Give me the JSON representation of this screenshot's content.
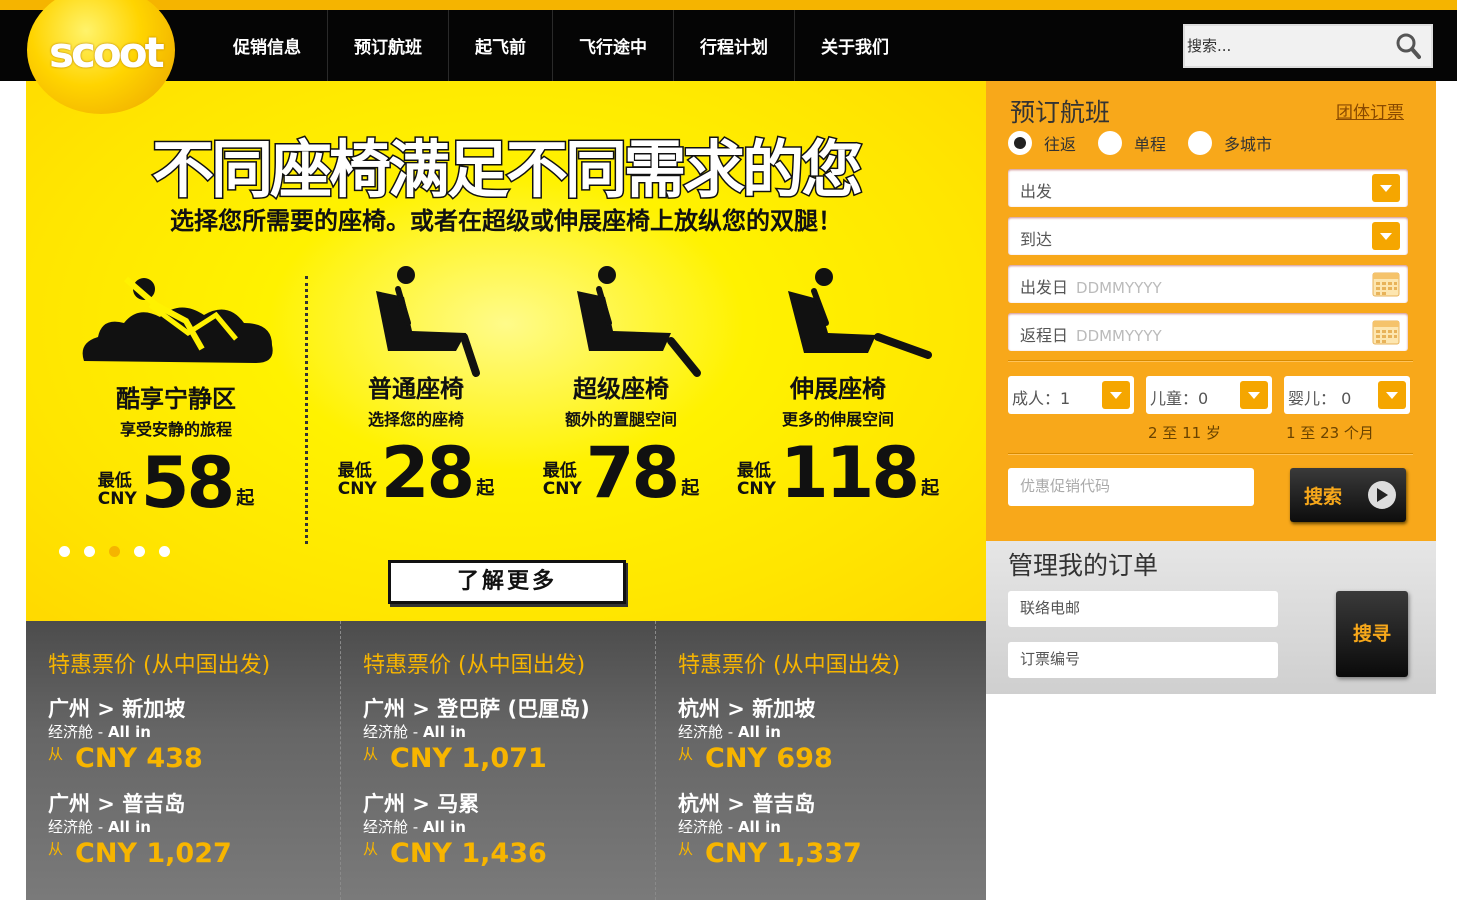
{
  "brand": {
    "logo_text": "scoot"
  },
  "nav": {
    "items": [
      "促销信息",
      "预订航班",
      "起飞前",
      "飞行途中",
      "行程计划",
      "关于我们"
    ],
    "search_placeholder": "搜索..."
  },
  "hero": {
    "title": "不同座椅满足不同需求的您",
    "subtitle": "选择您所需要的座椅。或者在超级或伸展座椅上放纵您的双腿！",
    "seats": [
      {
        "name": "酷享宁静区",
        "desc": "享受安静的旅程",
        "min_label_1": "最低",
        "min_label_2": "CNY",
        "price": "58",
        "suffix": "起"
      },
      {
        "name": "普通座椅",
        "desc": "选择您的座椅",
        "min_label_1": "最低",
        "min_label_2": "CNY",
        "price": "28",
        "suffix": "起"
      },
      {
        "name": "超级座椅",
        "desc": "额外的置腿空间",
        "min_label_1": "最低",
        "min_label_2": "CNY",
        "price": "78",
        "suffix": "起"
      },
      {
        "name": "伸展座椅",
        "desc": "更多的伸展空间",
        "min_label_1": "最低",
        "min_label_2": "CNY",
        "price": "118",
        "suffix": "起"
      }
    ],
    "carousel_active_index": 2,
    "learn_more": "了解更多"
  },
  "deals": {
    "columns": [
      {
        "heading": "特惠票价 (从中国出发)",
        "items": [
          {
            "route": "广州 > 新加坡",
            "class_prefix": "经济舱 - ",
            "class_name": "All in",
            "from": "从",
            "price": "CNY 438"
          },
          {
            "route": "广州 > 普吉岛",
            "class_prefix": "经济舱 - ",
            "class_name": "All in",
            "from": "从",
            "price": "CNY 1,027"
          }
        ]
      },
      {
        "heading": "特惠票价 (从中国出发)",
        "items": [
          {
            "route": "广州 > 登巴萨 (巴厘岛)",
            "class_prefix": "经济舱 - ",
            "class_name": "All in",
            "from": "从",
            "price": "CNY 1,071"
          },
          {
            "route": "广州 > 马累",
            "class_prefix": "经济舱 - ",
            "class_name": "All in",
            "from": "从",
            "price": "CNY 1,436"
          }
        ]
      },
      {
        "heading": "特惠票价 (从中国出发)",
        "items": [
          {
            "route": "杭州 > 新加坡",
            "class_prefix": "经济舱 - ",
            "class_name": "All in",
            "from": "从",
            "price": "CNY 698"
          },
          {
            "route": "杭州 > 普吉岛",
            "class_prefix": "经济舱 - ",
            "class_name": "All in",
            "from": "从",
            "price": "CNY 1,337"
          }
        ]
      }
    ]
  },
  "booking": {
    "title": "预订航班",
    "group_link": "团体订票",
    "trip_types": [
      "往返",
      "单程",
      "多城市"
    ],
    "selected_trip_type": "往返",
    "origin_label": "出发",
    "destination_label": "到达",
    "depart_label": "出发日",
    "depart_placeholder": "DDMMYYYY",
    "return_label": "返程日",
    "return_placeholder": "DDMMYYYY",
    "adults_label": "成人：1",
    "children_label": "儿童：0",
    "infants_label": "婴儿： 0",
    "children_hint": "2 至 11 岁",
    "infants_hint": "1 至 23 个月",
    "promo_placeholder": "优惠促销代码",
    "search_button": "搜索"
  },
  "manage": {
    "title": "管理我的订单",
    "contact_placeholder": "联络电邮",
    "booking_ref_placeholder": "订票编号",
    "search_button": "搜寻"
  },
  "colors": {
    "brand_yellow": "#f5b400",
    "panel_orange": "#f8a81a",
    "nav_black": "#050505",
    "deal_gray": "#666666"
  }
}
